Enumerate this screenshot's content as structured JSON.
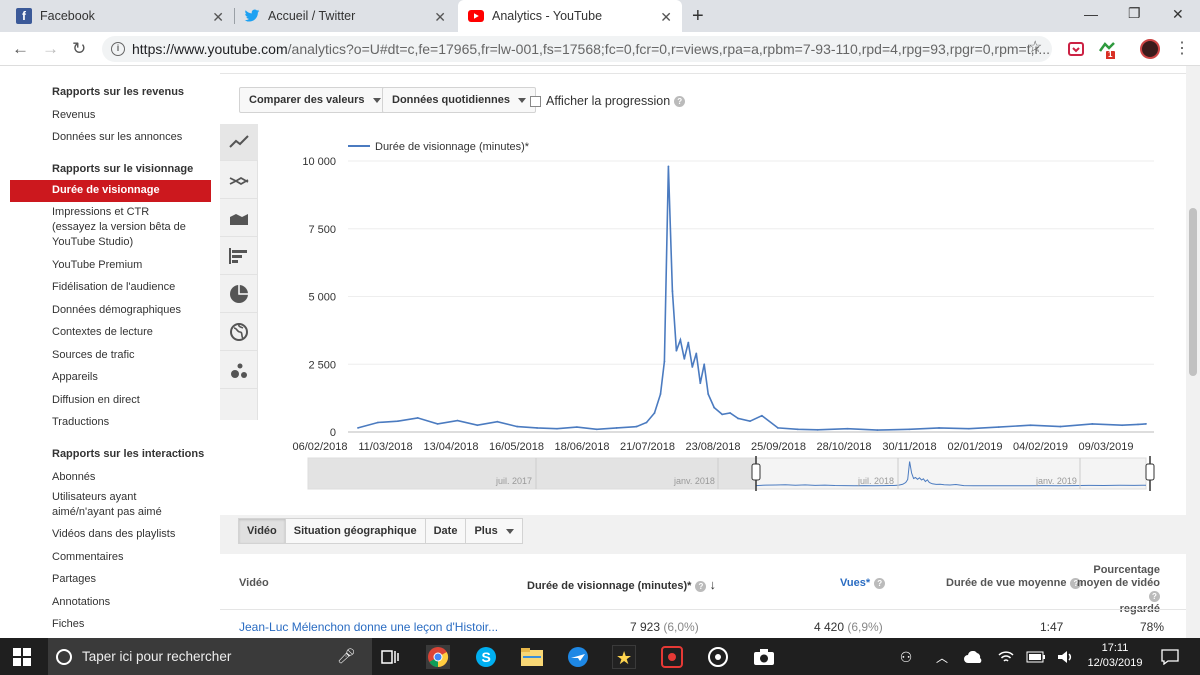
{
  "browser": {
    "tabs": [
      {
        "title": "Facebook",
        "icon": "facebook-icon",
        "color": "#3b5998"
      },
      {
        "title": "Accueil / Twitter",
        "icon": "twitter-icon",
        "color": "#1da1f2"
      },
      {
        "title": "Analytics - YouTube",
        "icon": "youtube-icon",
        "color": "#ff0000"
      }
    ],
    "url_prefix": "https://www.youtube.com",
    "url_rest": "/analytics?o=U#dt=c,fe=17965,fr=lw-001,fs=17568;fc=0,fcr=0,r=views,rpa=a,rpbm=7-93-110,rpd=4,rpg=93,rpgr=0,rpm=t,r...",
    "ext_badge": "1"
  },
  "sidebar": {
    "sections": [
      {
        "heading": "Rapports sur les revenus",
        "items": [
          "Revenus",
          "Données sur les annonces"
        ]
      },
      {
        "heading": "Rapports sur le visionnage",
        "items": [
          "Durée de visionnage",
          "Impressions et CTR",
          "(essayez la version bêta de",
          "YouTube Studio)",
          "YouTube Premium",
          "Fidélisation de l'audience",
          "Données démographiques",
          "Contextes de lecture",
          "Sources de trafic",
          "Appareils",
          "Diffusion en direct",
          "Traductions"
        ]
      },
      {
        "heading": "Rapports sur les interactions",
        "items": [
          "Abonnés",
          "Utilisateurs ayant",
          "aimé/n'ayant pas aimé",
          "Vidéos dans des playlists",
          "Commentaires",
          "Partages",
          "Annotations",
          "Fiches"
        ]
      }
    ]
  },
  "controls": {
    "compare": "Comparer des valeurs",
    "daily": "Données quotidiennes",
    "progress": "Afficher la progression"
  },
  "chart_icons": [
    "line-chart-icon",
    "multi-line-chart-icon",
    "area-chart-icon",
    "bar-chart-icon",
    "pie-chart-icon",
    "globe-icon",
    "bubble-chart-icon"
  ],
  "chart_data": {
    "type": "line",
    "legend": "Durée de visionnage (minutes)*",
    "color": "#4b7bc0",
    "ylim": [
      0,
      10000
    ],
    "yticks": [
      0,
      2500,
      5000,
      7500,
      10000
    ],
    "ytick_labels": [
      "0",
      "2 500",
      "5 000",
      "7 500",
      "10 000"
    ],
    "xtick_labels": [
      "06/02/2018",
      "11/03/2018",
      "13/04/2018",
      "16/05/2018",
      "18/06/2018",
      "21/07/2018",
      "23/08/2018",
      "25/09/2018",
      "28/10/2018",
      "30/11/2018",
      "02/01/2019",
      "04/02/2019",
      "09/03/2019"
    ],
    "x": [
      "2018-02-06",
      "2018-02-16",
      "2018-02-26",
      "2018-03-08",
      "2018-03-18",
      "2018-03-28",
      "2018-04-07",
      "2018-04-17",
      "2018-04-27",
      "2018-05-07",
      "2018-05-17",
      "2018-05-27",
      "2018-06-06",
      "2018-06-16",
      "2018-06-26",
      "2018-07-01",
      "2018-07-05",
      "2018-07-08",
      "2018-07-10",
      "2018-07-12",
      "2018-07-14",
      "2018-07-16",
      "2018-07-18",
      "2018-07-20",
      "2018-07-22",
      "2018-07-24",
      "2018-07-26",
      "2018-07-28",
      "2018-07-30",
      "2018-08-01",
      "2018-08-04",
      "2018-08-08",
      "2018-08-12",
      "2018-08-16",
      "2018-08-22",
      "2018-08-28",
      "2018-09-05",
      "2018-09-15",
      "2018-09-25",
      "2018-10-10",
      "2018-10-25",
      "2018-11-10",
      "2018-11-25",
      "2018-12-10",
      "2018-12-25",
      "2019-01-10",
      "2019-01-25",
      "2019-02-10",
      "2019-02-25",
      "2019-03-05",
      "2019-03-09"
    ],
    "y": [
      150,
      350,
      400,
      520,
      300,
      420,
      250,
      380,
      200,
      150,
      120,
      180,
      100,
      150,
      200,
      350,
      700,
      1400,
      2600,
      9800,
      5200,
      3000,
      3400,
      2700,
      3300,
      2400,
      2900,
      1800,
      2500,
      1400,
      900,
      650,
      700,
      500,
      400,
      600,
      150,
      100,
      80,
      120,
      70,
      100,
      150,
      120,
      180,
      250,
      200,
      300,
      250,
      280,
      300
    ],
    "nav_labels": [
      "juil. 2017",
      "janv. 2018",
      "juil. 2018",
      "janv. 2019"
    ]
  },
  "table": {
    "tabs": [
      "Vidéo",
      "Situation géographique",
      "Date",
      "Plus"
    ],
    "headers": {
      "video": "Vidéo",
      "watch": "Durée de visionnage (minutes)*",
      "views": "Vues*",
      "avg": "Durée de vue moyenne",
      "pct1": "Pourcentage",
      "pct2": "moyen de vidéo",
      "pct3": "regardé"
    },
    "row": {
      "title": "Jean-Luc Mélenchon donne une leçon d'Histoir...",
      "watch": "7 923",
      "watch_pct": "(6,0%)",
      "views": "4 420",
      "views_pct": "(6,9%)",
      "avg": "1:47",
      "pct": "78%"
    }
  },
  "taskbar": {
    "search_placeholder": "Taper ici pour rechercher",
    "time": "17:11",
    "date": "12/03/2019"
  }
}
